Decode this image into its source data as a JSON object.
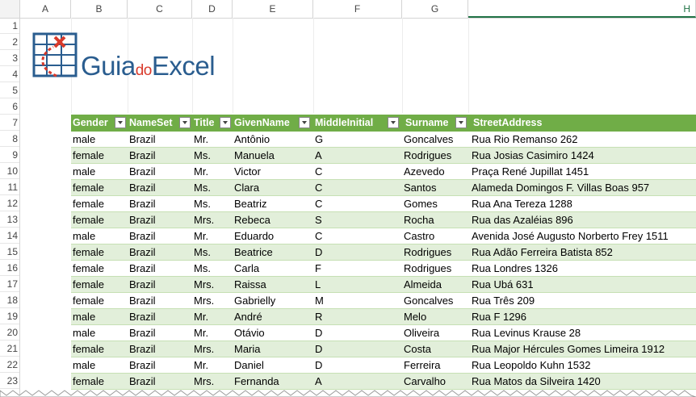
{
  "columns": [
    "A",
    "B",
    "C",
    "D",
    "E",
    "F",
    "G",
    "H"
  ],
  "rows": [
    "1",
    "2",
    "3",
    "4",
    "5",
    "6",
    "7",
    "8",
    "9",
    "10",
    "11",
    "12",
    "13",
    "14",
    "15",
    "16",
    "17",
    "18",
    "19",
    "20",
    "21",
    "22",
    "23"
  ],
  "logo": {
    "main1": "Guia",
    "small": "do",
    "main2": "Excel"
  },
  "colors": {
    "header_green": "#70ad47",
    "band_green": "#e2efda",
    "logo_blue": "#2a5d8f",
    "logo_red": "#d93a2b"
  },
  "table": {
    "headers": [
      "Gender",
      "NameSet",
      "Title",
      "GivenName",
      "MiddleInitial",
      "Surname",
      "StreetAddress"
    ],
    "rows": [
      [
        "male",
        "Brazil",
        "Mr.",
        "Antônio",
        "G",
        "Goncalves",
        "Rua Rio Remanso 262"
      ],
      [
        "female",
        "Brazil",
        "Ms.",
        "Manuela",
        "A",
        "Rodrigues",
        "Rua Josias Casimiro 1424"
      ],
      [
        "male",
        "Brazil",
        "Mr.",
        "Victor",
        "C",
        "Azevedo",
        "Praça René Jupillat 1451"
      ],
      [
        "female",
        "Brazil",
        "Ms.",
        "Clara",
        "C",
        "Santos",
        "Alameda Domingos F. Villas Boas 957"
      ],
      [
        "female",
        "Brazil",
        "Ms.",
        "Beatriz",
        "C",
        "Gomes",
        "Rua Ana Tereza 1288"
      ],
      [
        "female",
        "Brazil",
        "Mrs.",
        "Rebeca",
        "S",
        "Rocha",
        "Rua das Azaléias 896"
      ],
      [
        "male",
        "Brazil",
        "Mr.",
        "Eduardo",
        "C",
        "Castro",
        "Avenida José Augusto Norberto Frey 1511"
      ],
      [
        "female",
        "Brazil",
        "Ms.",
        "Beatrice",
        "D",
        "Rodrigues",
        "Rua Adão Ferreira Batista 852"
      ],
      [
        "female",
        "Brazil",
        "Ms.",
        "Carla",
        "F",
        "Rodrigues",
        "Rua Londres 1326"
      ],
      [
        "female",
        "Brazil",
        "Mrs.",
        "Raissa",
        "L",
        "Almeida",
        "Rua Ubá 631"
      ],
      [
        "female",
        "Brazil",
        "Mrs.",
        "Gabrielly",
        "M",
        "Goncalves",
        "Rua Três 209"
      ],
      [
        "male",
        "Brazil",
        "Mr.",
        "André",
        "R",
        "Melo",
        "Rua F 1296"
      ],
      [
        "male",
        "Brazil",
        "Mr.",
        "Otávio",
        "D",
        "Oliveira",
        "Rua Levinus Krause 28"
      ],
      [
        "female",
        "Brazil",
        "Mrs.",
        "Maria",
        "D",
        "Costa",
        "Rua Major Hércules Gomes Limeira 1912"
      ],
      [
        "male",
        "Brazil",
        "Mr.",
        "Daniel",
        "D",
        "Ferreira",
        "Rua Leopoldo Kuhn 1532"
      ],
      [
        "female",
        "Brazil",
        "Mrs.",
        "Fernanda",
        "A",
        "Carvalho",
        "Rua Matos da Silveira 1420"
      ]
    ]
  }
}
